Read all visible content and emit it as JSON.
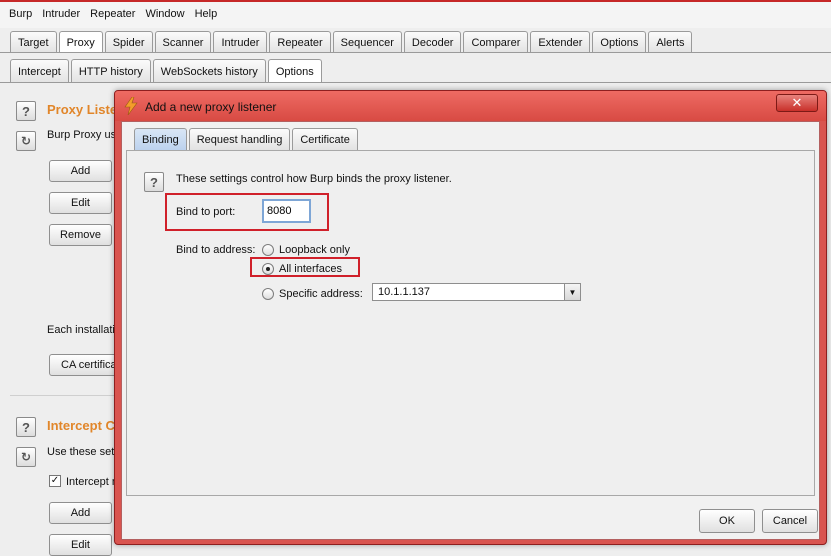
{
  "menubar": {
    "items": [
      "Burp",
      "Intruder",
      "Repeater",
      "Window",
      "Help"
    ]
  },
  "main_tabs": [
    "Target",
    "Proxy",
    "Spider",
    "Scanner",
    "Intruder",
    "Repeater",
    "Sequencer",
    "Decoder",
    "Comparer",
    "Extender",
    "Options",
    "Alerts"
  ],
  "main_tabs_active": "Proxy",
  "sub_tabs": [
    "Intercept",
    "HTTP history",
    "WebSockets history",
    "Options"
  ],
  "sub_tabs_active": "Options",
  "background": {
    "proxy_listeners_title": "Proxy Liste",
    "proxy_listeners_desc": "Burp Proxy us",
    "add_label": "Add",
    "edit_label": "Edit",
    "remove_label": "Remove",
    "each_installation_text": "Each installatio",
    "ca_cert_label": "CA certifica",
    "intercept_title": "Intercept C",
    "intercept_desc": "Use these set",
    "intercept_checkbox_label": "Intercept r",
    "add2_label": "Add",
    "edit2_label": "Edit"
  },
  "dialog": {
    "title": "Add a new proxy listener",
    "close_glyph": "✕",
    "tabs": [
      "Binding",
      "Request handling",
      "Certificate"
    ],
    "active_tab": "Binding",
    "help_glyph": "?",
    "description": "These settings control how Burp binds the proxy listener.",
    "bind_port_label": "Bind to port:",
    "bind_port_value": "8080",
    "bind_address_label": "Bind to address:",
    "loopback_label": "Loopback only",
    "all_interfaces_label": "All interfaces",
    "specific_address_label": "Specific address:",
    "specific_address_value": "10.1.1.137",
    "selected_option": "All interfaces",
    "ok_label": "OK",
    "cancel_label": "Cancel"
  },
  "colors": {
    "accent_orange": "#e1862a",
    "dialog_red": "#d9544f",
    "highlight_red": "#d0202a"
  }
}
